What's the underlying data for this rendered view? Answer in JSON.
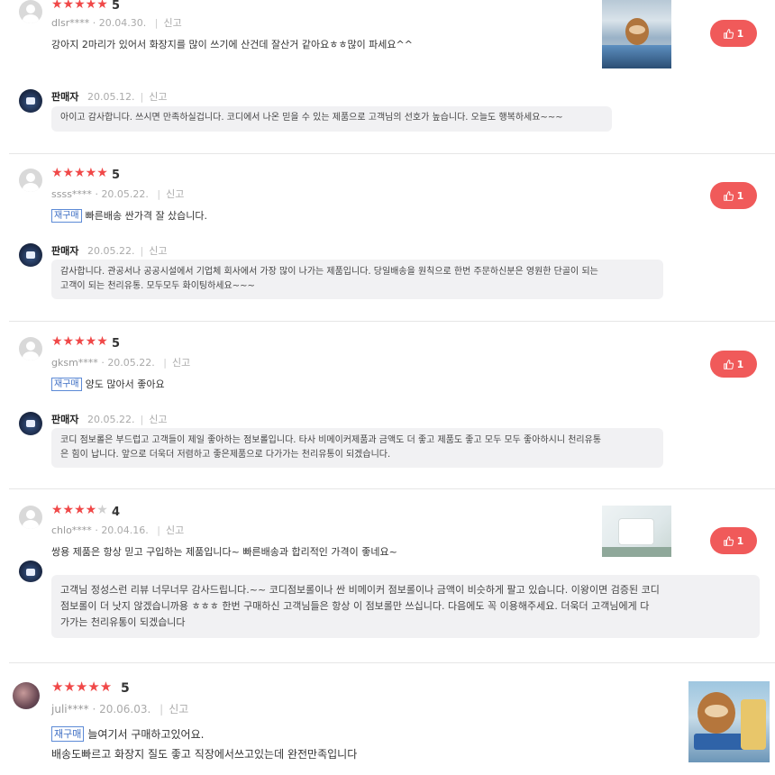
{
  "reviews": [
    {
      "rating": 5,
      "stars_filled": "★★★★★",
      "stars_empty": "",
      "score": "5",
      "user": "dlsr****",
      "date": "20.04.30.",
      "report": "신고",
      "repurchase": false,
      "badge": "",
      "text": "강아지 2마리가 있어서 화장지를 많이 쓰기에 산건데 잘산거 같아요ㅎㅎ많이 파세요^^",
      "text2": "",
      "likes": "1",
      "has_photo": true,
      "reply": {
        "seller": "판매자",
        "date": "20.05.12.",
        "report": "신고",
        "line1": "아이고 감사합니다. 쓰시면 만족하실겁니다. 코디에서 나온 믿을 수 있는 제품으로 고객님의 선호가 높습니다. 오늘도 행복하세요~~~",
        "line2": ""
      }
    },
    {
      "rating": 5,
      "stars_filled": "★★★★★",
      "stars_empty": "",
      "score": "5",
      "user": "ssss****",
      "date": "20.05.22.",
      "report": "신고",
      "repurchase": true,
      "badge": "재구매",
      "text": "빠른배송 싼가격 잘 샀습니다.",
      "text2": "",
      "likes": "1",
      "has_photo": false,
      "reply": {
        "seller": "판매자",
        "date": "20.05.22.",
        "report": "신고",
        "line1": "감사합니다. 관공서나 공공시설에서 기업체 회사에서 가장 많이 나가는 제품입니다. 당일배송을 원칙으로 한번 주문하신분은 영원한 단골이 되는",
        "line2": "고객이 되는 천리유통. 모두모두 화이팅하세요~~~"
      }
    },
    {
      "rating": 5,
      "stars_filled": "★★★★★",
      "stars_empty": "",
      "score": "5",
      "user": "gksm****",
      "date": "20.05.22.",
      "report": "신고",
      "repurchase": true,
      "badge": "재구매",
      "text": "양도 많아서 좋아요",
      "text2": "",
      "likes": "1",
      "has_photo": false,
      "reply": {
        "seller": "판매자",
        "date": "20.05.22.",
        "report": "신고",
        "line1": "코디 점보롤은 부드럽고 고객들이 제일 좋아하는 점보롤입니다. 타사 비메이커제품과 금액도 더 좋고 제품도 좋고 모두 모두 좋아하시니 천리유통",
        "line2": "은 힘이 납니다. 앞으로 더욱더 저렴하고 좋은제품으로 다가가는 천리유통이 되겠습니다."
      }
    },
    {
      "rating": 4,
      "stars_filled": "★★★★",
      "stars_empty": "★",
      "score": "4",
      "user": "chlo****",
      "date": "20.04.16.",
      "report": "신고",
      "repurchase": false,
      "badge": "",
      "text": "쌍용 제품은 항상 믿고 구입하는 제품입니다~ 빠른배송과 합리적인 가격이 좋네요~",
      "text2": "",
      "likes": "1",
      "has_photo": true,
      "reply": {
        "seller": "",
        "date": "",
        "report": "",
        "line1": "고객님 정성스런 리뷰 너무너무 감사드립니다.~~ 코디점보롤이나 싼 비메이커 점보롤이나 금액이 비슷하게 팔고 있습니다. 이왕이면 검증된 코디",
        "line2": "점보롤이 더 낫지 않겠습니까용 ㅎㅎㅎ 한번 구매하신 고객님들은 항상 이 점보롤만 쓰십니다. 다음에도 꼭 이용해주세요. 더욱더 고객님에게 다",
        "line3": "가가는 천리유통이 되겠습니다"
      }
    },
    {
      "rating": 5,
      "stars_filled": "★★★★★",
      "stars_empty": "",
      "score": "5",
      "user": "juli****",
      "date": "20.06.03.",
      "report": "신고",
      "repurchase": true,
      "badge": "재구매",
      "text": "늘여기서 구매하고있어요.",
      "text2": "배송도빠르고 화장지 질도 좋고 직장에서쓰고있는데 완전만족입니다",
      "likes": "",
      "has_photo": true,
      "reply": null
    }
  ],
  "colors": {
    "star": "#f04848",
    "like_bg": "#f05a5a",
    "badge": "#3f6fc4",
    "reply_bg": "#f1f1f3"
  },
  "icons": {
    "like": "thumbs-up-icon",
    "avatar": "user-avatar-icon"
  }
}
